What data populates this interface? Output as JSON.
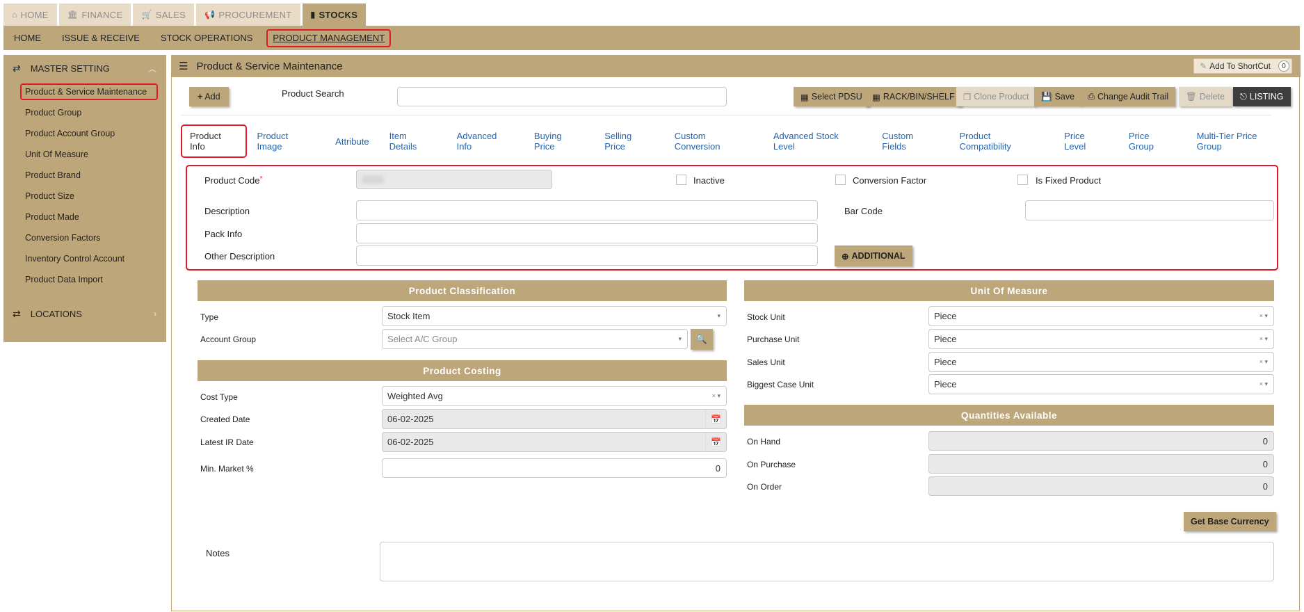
{
  "module_tabs": [
    {
      "label": "HOME",
      "icon": "home-icon"
    },
    {
      "label": "FINANCE",
      "icon": "bank-icon"
    },
    {
      "label": "SALES",
      "icon": "cart-icon"
    },
    {
      "label": "PROCUREMENT",
      "icon": "megaphone-icon"
    },
    {
      "label": "STOCKS",
      "icon": "bar-chart-icon"
    }
  ],
  "subnav": [
    "HOME",
    "ISSUE & RECEIVE",
    "STOCK OPERATIONS",
    "PRODUCT MANAGEMENT"
  ],
  "sidebar": {
    "section_title": "MASTER SETTING",
    "items": [
      "Product & Service Maintenance",
      "Product Group",
      "Product Account Group",
      "Unit Of Measure",
      "Product Brand",
      "Product Size",
      "Product Made",
      "Conversion Factors",
      "Inventory Control Account",
      "Product Data Import"
    ],
    "locations_title": "LOCATIONS"
  },
  "panel": {
    "title": "Product & Service Maintenance",
    "shortcut_label": "Add To ShortCut",
    "shortcut_count": "0"
  },
  "toolbar": {
    "add": "Add",
    "search_label": "Product Search",
    "search_value": "",
    "select_pdsu": "Select PDSU",
    "rack": "RACK/BIN/SHELF",
    "clone": "Clone Product",
    "save": "Save",
    "audit": "Change Audit Trail",
    "delete": "Delete",
    "listing": "LISTING"
  },
  "tabs": [
    "Product Info",
    "Product Image",
    "Attribute",
    "Item Details",
    "Advanced Info",
    "Buying Price",
    "Selling Price",
    "Custom Conversion",
    "Advanced Stock Level",
    "Custom Fields",
    "Product Compatibility",
    "Price Level",
    "Price Group",
    "Multi-Tier Price Group"
  ],
  "info": {
    "product_code_label": "Product Code",
    "required_mark": "*",
    "product_code_value": "",
    "inactive_label": "Inactive",
    "conversion_factor_label": "Conversion Factor",
    "fixed_product_label": "Is Fixed Product",
    "description_label": "Description",
    "description_value": "",
    "barcode_label": "Bar Code",
    "barcode_value": "",
    "pack_info_label": "Pack Info",
    "pack_info_value": "",
    "other_desc_label": "Other Description",
    "other_desc_value": "",
    "additional_button": "ADDITIONAL"
  },
  "classification": {
    "title": "Product Classification",
    "type_label": "Type",
    "type_value": "Stock Item",
    "account_group_label": "Account Group",
    "account_group_placeholder": "Select A/C Group"
  },
  "costing": {
    "title": "Product Costing",
    "cost_type_label": "Cost Type",
    "cost_type_value": "Weighted Avg",
    "created_date_label": "Created Date",
    "created_date_value": "06-02-2025",
    "latest_ir_label": "Latest IR Date",
    "latest_ir_value": "06-02-2025",
    "min_market_label": "Min. Market %",
    "min_market_value": "0"
  },
  "uom": {
    "title": "Unit Of Measure",
    "stock_unit_label": "Stock Unit",
    "stock_unit_value": "Piece",
    "purchase_unit_label": "Purchase Unit",
    "purchase_unit_value": "Piece",
    "sales_unit_label": "Sales Unit",
    "sales_unit_value": "Piece",
    "biggest_case_label": "Biggest Case Unit",
    "biggest_case_value": "Piece"
  },
  "quantities": {
    "title": "Quantities Available",
    "on_hand_label": "On Hand",
    "on_hand_value": "0",
    "on_purchase_label": "On Purchase",
    "on_purchase_value": "0",
    "on_order_label": "On Order",
    "on_order_value": "0"
  },
  "base_currency_button": "Get Base Currency",
  "notes_label": "Notes",
  "notes_value": "",
  "colors": {
    "accent": "#bea67b",
    "highlight": "#e0182a",
    "link": "#2565b0"
  }
}
